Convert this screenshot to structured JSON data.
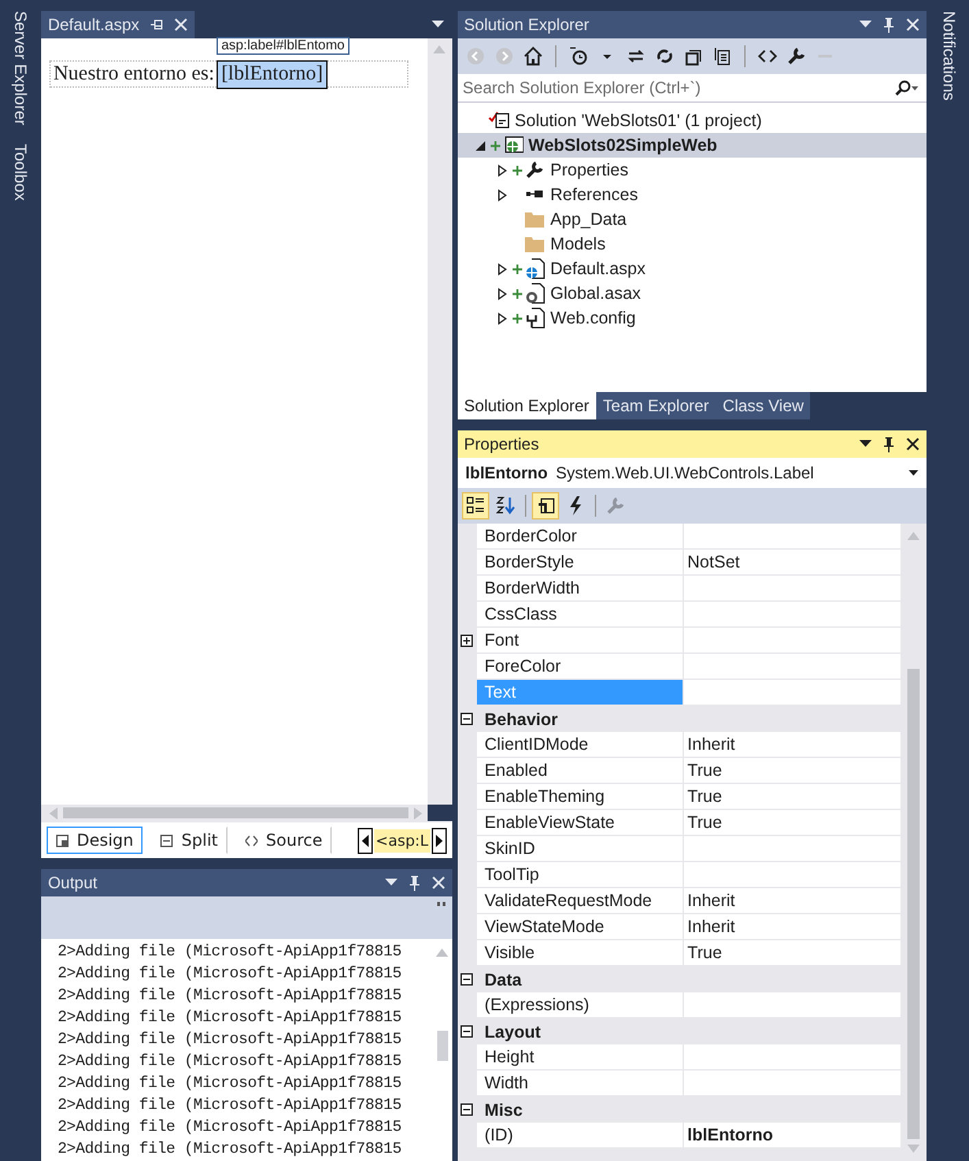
{
  "left_strip": {
    "tabs": [
      {
        "label": "Server Explorer"
      },
      {
        "label": "Toolbox"
      }
    ]
  },
  "designer": {
    "tab_title": "Default.aspx",
    "tag_hint": "asp:label#lblEntomo",
    "content_text": "Nuestro entorno es:",
    "label_control": "[lblEntorno]",
    "view_tabs": [
      {
        "kind": "design",
        "label": "Design",
        "selected": true
      },
      {
        "kind": "split",
        "label": "Split",
        "selected": false
      },
      {
        "kind": "source",
        "label": "Source",
        "selected": false
      }
    ],
    "breadcrumb": "<asp:L"
  },
  "output": {
    "title": "Output",
    "lines": [
      "2>Adding file (Microsoft-ApiApp1f78815",
      "2>Adding file (Microsoft-ApiApp1f78815",
      "2>Adding file (Microsoft-ApiApp1f78815",
      "2>Adding file (Microsoft-ApiApp1f78815",
      "2>Adding file (Microsoft-ApiApp1f78815",
      "2>Adding file (Microsoft-ApiApp1f78815",
      "2>Adding file (Microsoft-ApiApp1f78815",
      "2>Adding file (Microsoft-ApiApp1f78815",
      "2>Adding file (Microsoft-ApiApp1f78815",
      "2>Adding file (Microsoft-ApiApp1f78815"
    ]
  },
  "solution_explorer": {
    "title": "Solution Explorer",
    "search_placeholder": "Search Solution Explorer (Ctrl+`)",
    "tree": [
      {
        "kind": "solution",
        "label": "Solution 'WebSlots01' (1 project)",
        "expander": false,
        "pending_add": false,
        "selected": false,
        "children": [
          {
            "kind": "project",
            "label": "WebSlots02SimpleWeb",
            "expander": true,
            "expanded": true,
            "pending_add": true,
            "selected": true,
            "children": [
              {
                "kind": "properties",
                "label": "Properties",
                "expander": true,
                "expanded": false,
                "pending_add": true,
                "selected": false
              },
              {
                "kind": "references",
                "label": "References",
                "expander": true,
                "expanded": false,
                "pending_add": false,
                "selected": false
              },
              {
                "kind": "folder",
                "label": "App_Data",
                "expander": false,
                "pending_add": false,
                "selected": false
              },
              {
                "kind": "folder",
                "label": "Models",
                "expander": false,
                "pending_add": false,
                "selected": false
              },
              {
                "kind": "webpage",
                "label": "Default.aspx",
                "expander": true,
                "expanded": false,
                "pending_add": true,
                "selected": false
              },
              {
                "kind": "globalfile",
                "label": "Global.asax",
                "expander": true,
                "expanded": false,
                "pending_add": true,
                "selected": false
              },
              {
                "kind": "config",
                "label": "Web.config",
                "expander": true,
                "expanded": false,
                "pending_add": true,
                "selected": false
              }
            ]
          }
        ]
      }
    ],
    "bottom_tabs": [
      {
        "label": "Solution Explorer",
        "selected": true
      },
      {
        "label": "Team Explorer",
        "selected": false
      },
      {
        "label": "Class View",
        "selected": false
      }
    ]
  },
  "properties": {
    "title": "Properties",
    "object_name": "lblEntorno",
    "object_type": "System.Web.UI.WebControls.Label",
    "toolbar": [
      {
        "kind": "categorized",
        "selected": true,
        "disabled": false
      },
      {
        "kind": "alphabetical",
        "selected": false,
        "disabled": false
      },
      {
        "kind": "properties",
        "selected": true,
        "disabled": false
      },
      {
        "kind": "events",
        "selected": false,
        "disabled": false
      },
      {
        "kind": "pages",
        "selected": false,
        "disabled": true
      }
    ],
    "rows": [
      {
        "kind": "property",
        "name": "BorderColor",
        "selected": false
      },
      {
        "kind": "property",
        "name": "BorderStyle",
        "value": "NotSet",
        "selected": false,
        "modified": false
      },
      {
        "kind": "property",
        "name": "BorderWidth",
        "selected": false
      },
      {
        "kind": "property",
        "name": "CssClass",
        "selected": false
      },
      {
        "kind": "group",
        "name": "Font",
        "expanded": false,
        "selected": false
      },
      {
        "kind": "property",
        "name": "ForeColor",
        "selected": false
      },
      {
        "kind": "property",
        "name": "Text",
        "selected": true
      },
      {
        "kind": "category",
        "name": "Behavior",
        "expanded": true
      },
      {
        "kind": "property",
        "name": "ClientIDMode",
        "value": "Inherit",
        "selected": false,
        "modified": false
      },
      {
        "kind": "property",
        "name": "Enabled",
        "value": "True",
        "selected": false,
        "modified": false
      },
      {
        "kind": "property",
        "name": "EnableTheming",
        "value": "True",
        "selected": false,
        "modified": false
      },
      {
        "kind": "property",
        "name": "EnableViewState",
        "value": "True",
        "selected": false,
        "modified": false
      },
      {
        "kind": "property",
        "name": "SkinID",
        "selected": false
      },
      {
        "kind": "property",
        "name": "ToolTip",
        "selected": false
      },
      {
        "kind": "property",
        "name": "ValidateRequestMode",
        "value": "Inherit",
        "selected": false,
        "modified": false
      },
      {
        "kind": "property",
        "name": "ViewStateMode",
        "value": "Inherit",
        "selected": false,
        "modified": false
      },
      {
        "kind": "property",
        "name": "Visible",
        "value": "True",
        "selected": false,
        "modified": false
      },
      {
        "kind": "category",
        "name": "Data",
        "expanded": true
      },
      {
        "kind": "property",
        "name": "(Expressions)",
        "selected": false
      },
      {
        "kind": "category",
        "name": "Layout",
        "expanded": true
      },
      {
        "kind": "property",
        "name": "Height",
        "selected": false
      },
      {
        "kind": "property",
        "name": "Width",
        "selected": false
      },
      {
        "kind": "category",
        "name": "Misc",
        "expanded": true
      },
      {
        "kind": "property",
        "name": "(ID)",
        "value": "lblEntorno",
        "selected": false,
        "modified": true
      }
    ]
  },
  "right_strip": {
    "tabs": [
      {
        "label": "Notifications"
      }
    ]
  }
}
